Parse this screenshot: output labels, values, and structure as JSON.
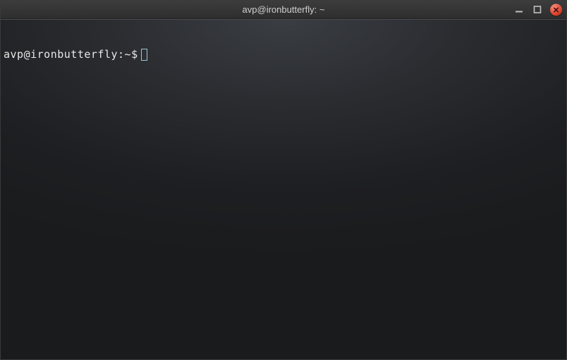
{
  "window": {
    "title": "avp@ironbutterfly: ~"
  },
  "terminal": {
    "prompt": "avp@ironbutterfly:~$",
    "input": ""
  },
  "icons": {
    "minimize": "minimize-icon",
    "maximize": "maximize-icon",
    "close": "close-icon"
  }
}
